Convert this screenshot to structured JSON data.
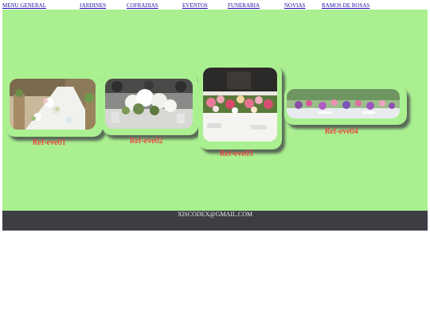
{
  "nav": {
    "items": [
      {
        "label": "MENU GENERAL"
      },
      {
        "label": "JARDINES"
      },
      {
        "label": "COFRADIAS"
      },
      {
        "label": "EVENTOS"
      },
      {
        "label": "FUNERARIA"
      },
      {
        "label": "NOVIAS"
      },
      {
        "label": "RAMOS DE ROSAS"
      }
    ]
  },
  "gallery": {
    "items": [
      {
        "ref": "Ref-eve01",
        "image": "banquet-table-flowers-photo"
      },
      {
        "ref": "Ref-eve02",
        "image": "white-flower-centerpiece-photo"
      },
      {
        "ref": "Ref-eve03",
        "image": "pink-rose-table-runner-photo"
      },
      {
        "ref": "Ref-eve04",
        "image": "purple-flower-table-photo"
      }
    ]
  },
  "footer": {
    "email": "XISCODEX@GMAIL.COM"
  },
  "colors": {
    "stage": "#aaf090",
    "footer": "#3c3e44",
    "ref_text": "#e03030",
    "link": "#1a0dab"
  }
}
